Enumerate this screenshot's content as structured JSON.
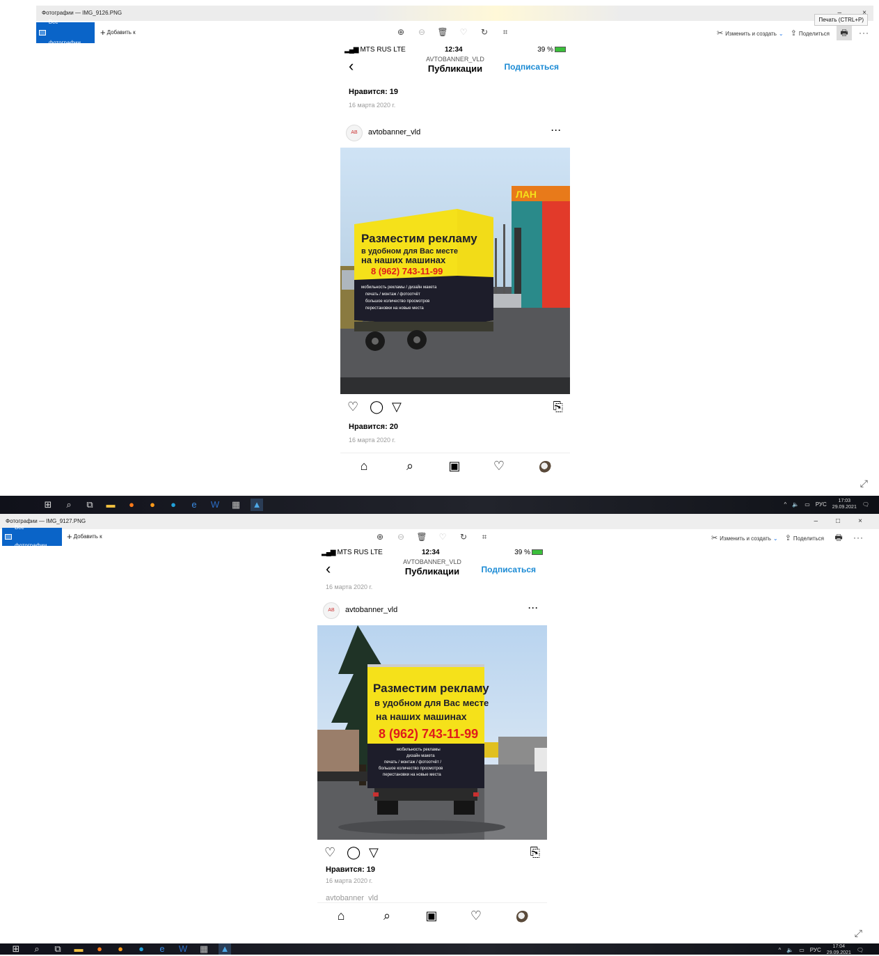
{
  "shot1": {
    "window_title": "Фотографии — IMG_9126.PNG",
    "all_photos": "Все фотографии",
    "add_to": "Добавить к",
    "edit_create": "Изменить и создать",
    "share": "Поделиться",
    "print_tooltip": "Печать (CTRL+P)",
    "phone": {
      "carrier": "MTS RUS  LTE",
      "time": "12:34",
      "battery": "39 %",
      "account": "AVTOBANNER_VLD",
      "section": "Публикации",
      "follow": "Подписаться",
      "prev_likes": "Нравится: 19",
      "prev_date": "16 марта 2020 г.",
      "username": "avtobanner_vld",
      "likes": "Нравится: 20",
      "date": "16 марта 2020 г.",
      "banner": {
        "line1": "Разместим рекламу",
        "line2": "в удобном для Вас месте",
        "line3": "на наших машинах",
        "phone": "8 (962) 743-11-99",
        "small1": "мобильность рекламы / дизайн макета",
        "small2": "печать / монтаж / фотоотчёт",
        "small3": "большое количество просмотров",
        "small4": "перестановки на новые места"
      },
      "store_sign": "ЛАН"
    },
    "clock_time": "17:03",
    "clock_date": "29.09.2021",
    "lang": "РУС"
  },
  "shot2": {
    "window_title": "Фотографии — IMG_9127.PNG",
    "all_photos": "Все фотографии",
    "add_to": "Добавить к",
    "edit_create": "Изменить и создать",
    "share": "Поделиться",
    "phone": {
      "carrier": "MTS RUS  LTE",
      "time": "12:34",
      "battery": "39 %",
      "account": "AVTOBANNER_VLD",
      "section": "Публикации",
      "follow": "Подписаться",
      "prev_date": "16 марта 2020 г.",
      "username": "avtobanner_vld",
      "likes": "Нравится: 19",
      "date": "16 марта 2020 г.",
      "next_username": "avtobanner_vld",
      "banner": {
        "line1": "Разместим рекламу",
        "line2": "в удобном для Вас месте",
        "line3": "на наших машинах",
        "phone": "8 (962) 743-11-99",
        "small1": "мобильность рекламы",
        "small2": "дизайн макета",
        "small3": "печать / монтаж / фотоотчёт /",
        "small4": "большое количество просмотров",
        "small5": "перестановки на новые места"
      }
    },
    "clock_time": "17:04",
    "clock_date": "29.09.2021",
    "lang": "РУС"
  },
  "icons": {
    "zoom_in": "zoom-in-icon",
    "zoom_out": "zoom-out-icon",
    "delete": "trash-icon",
    "favorite": "heart-icon",
    "rotate": "rotate-icon",
    "crop": "crop-icon",
    "print": "printer-icon",
    "more": "more-icon"
  },
  "colors": {
    "accent": "#0a64c8",
    "follow": "#1a8ad4",
    "banner_yellow": "#f5e11a",
    "banner_red": "#e01b1b"
  }
}
